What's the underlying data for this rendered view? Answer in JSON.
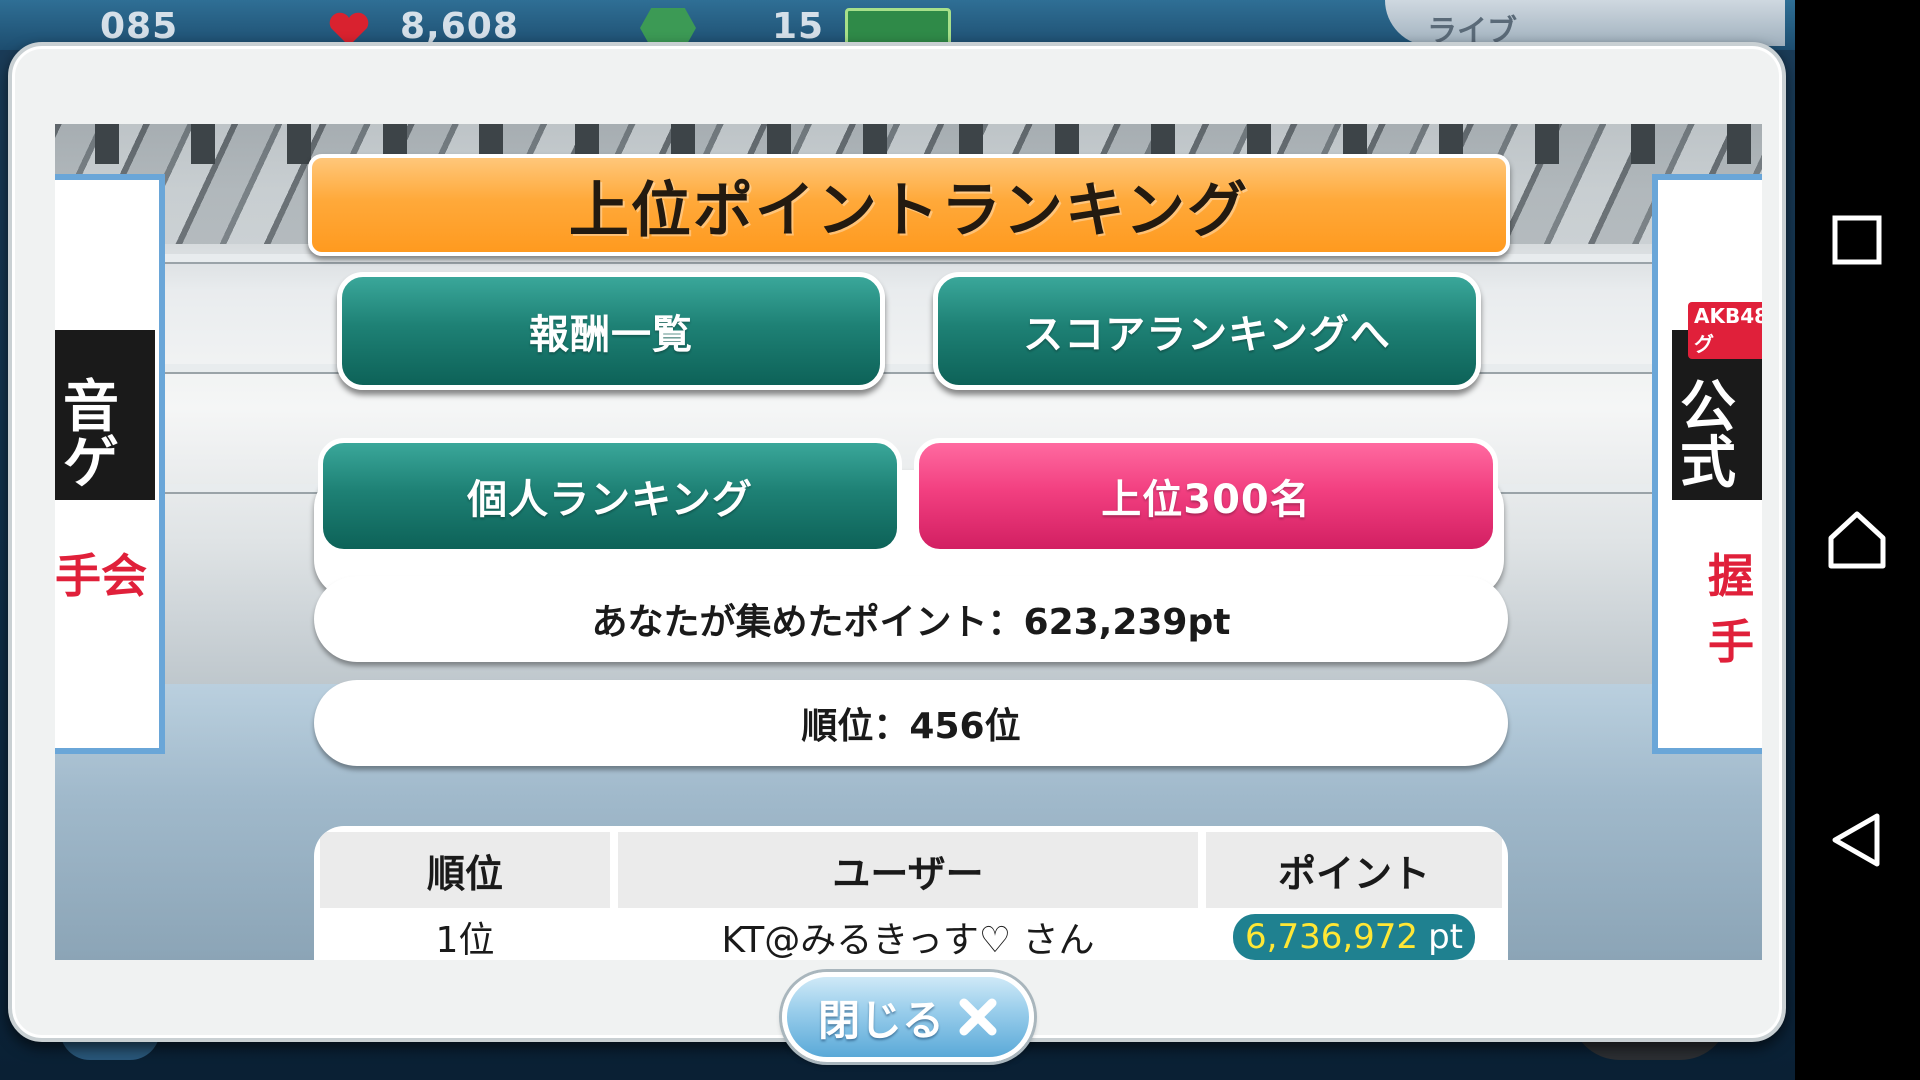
{
  "hud": {
    "stamina_partial": "085",
    "points_partial": "8,608",
    "gem_count_partial": "15",
    "live_tab_label": "ライブ"
  },
  "modal": {
    "title": "上位ポイントランキング",
    "buttons": {
      "rewards_list": "報酬一覧",
      "to_score_ranking": "スコアランキングへ"
    },
    "tabs": [
      {
        "label": "個人ランキング",
        "selected": false
      },
      {
        "label": "上位300名",
        "selected": true
      }
    ],
    "my_points": "あなたが集めたポイント：623,239pt",
    "my_rank": "順位：456位",
    "table": {
      "headers": [
        "順位",
        "ユーザー",
        "ポイント"
      ],
      "rows": [
        {
          "rank": "1位",
          "user": "KT@みるきっす♡ さん",
          "points_value": "6,736,972",
          "points_unit": "pt"
        }
      ]
    },
    "close_label": "閉じる"
  },
  "stage_banners": {
    "left_red": "手会",
    "right_red": "握手",
    "right_tag": "AKB48グ",
    "right_main": "公式",
    "left_main": "音ゲ"
  },
  "colors": {
    "title_orange": "#ffa93a",
    "teal": "#1e8175",
    "pink": "#f23f80",
    "close_blue": "#5aa9d8",
    "points_highlight": "#ffe735"
  },
  "navbar": {
    "icons": [
      "recent-apps-icon",
      "home-icon",
      "back-icon"
    ]
  }
}
